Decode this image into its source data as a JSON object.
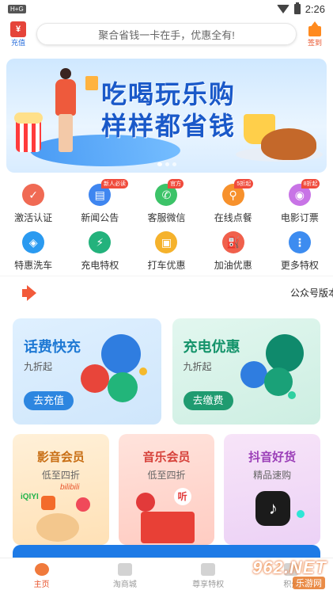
{
  "status_bar": {
    "left_badge": "H+G",
    "time": "2:26"
  },
  "header": {
    "recharge_label": "充值",
    "search_text": "聚合省钱一卡在手，优惠全有!",
    "checkin_label": "签到"
  },
  "banner": {
    "line1": "吃喝玩乐购",
    "line2": "样样都省钱",
    "popcorn_text": "POP",
    "slides": 3,
    "active_slide": 1
  },
  "grid": [
    {
      "label": "激活认证",
      "icon": "check-icon",
      "color": "#f06a54",
      "badge": ""
    },
    {
      "label": "新闻公告",
      "icon": "news-icon",
      "color": "#3f86f0",
      "badge": "新人必读"
    },
    {
      "label": "客服微信",
      "icon": "wechat-icon",
      "color": "#3cc368",
      "badge": "官方"
    },
    {
      "label": "在线点餐",
      "icon": "fork-knife-icon",
      "color": "#f7912c",
      "badge": "5折起"
    },
    {
      "label": "电影订票",
      "icon": "film-icon",
      "color": "#c874e6",
      "badge": "8折起"
    },
    {
      "label": "特惠洗车",
      "icon": "car-wash-icon",
      "color": "#2a9af0",
      "badge": ""
    },
    {
      "label": "充电特权",
      "icon": "charging-icon",
      "color": "#23b27c",
      "badge": ""
    },
    {
      "label": "打车优惠",
      "icon": "taxi-icon",
      "color": "#f5b22c",
      "badge": ""
    },
    {
      "label": "加油优惠",
      "icon": "fuel-icon",
      "color": "#f0604c",
      "badge": ""
    },
    {
      "label": "更多特权",
      "icon": "more-grid-icon",
      "color": "#3d8cf0",
      "badge": ""
    }
  ],
  "notice": {
    "text": "公众号版本"
  },
  "big_cards": [
    {
      "title": "话费快充",
      "subtitle": "九折起",
      "button": "去充值"
    },
    {
      "title": "充电优惠",
      "subtitle": "九折起",
      "button": "去缴费"
    }
  ],
  "small_cards": [
    {
      "title": "影音会员",
      "subtitle": "低至四折",
      "logo_text": "bilibili",
      "logo_text2": "iQIYI"
    },
    {
      "title": "音乐会员",
      "subtitle": "低至四折",
      "logo_text": "听"
    },
    {
      "title": "抖音好货",
      "subtitle": "精品速购"
    }
  ],
  "tabs": [
    {
      "label": "主页",
      "active": true
    },
    {
      "label": "淘商城",
      "active": false
    },
    {
      "label": "尊享特权",
      "active": false
    },
    {
      "label": "积分",
      "active": false
    }
  ],
  "watermark": {
    "number": "962.NET",
    "sub": "乐游网"
  },
  "colors": {
    "accent": "#e8542c",
    "brand_blue": "#2d86e0",
    "brand_green": "#1f9b70"
  }
}
